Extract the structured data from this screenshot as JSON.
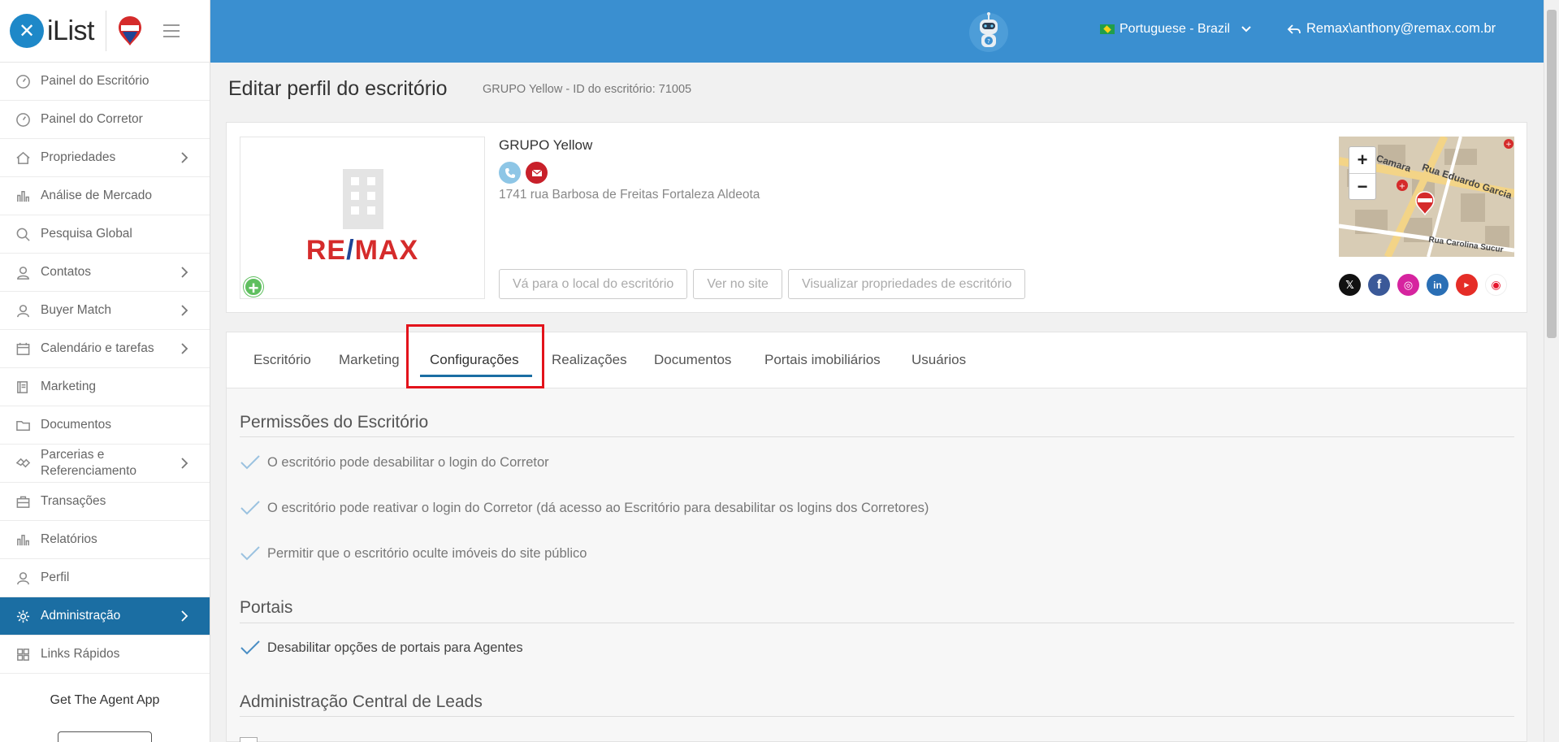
{
  "brand": {
    "name": "iList"
  },
  "nav": [
    {
      "label": "Painel do Escritório",
      "icon": "gauge-icon",
      "chevron": false
    },
    {
      "label": "Painel do Corretor",
      "icon": "gauge-icon",
      "chevron": false
    },
    {
      "label": "Propriedades",
      "icon": "home-icon",
      "chevron": true
    },
    {
      "label": "Análise de Mercado",
      "icon": "bar-chart-icon",
      "chevron": false
    },
    {
      "label": "Pesquisa Global",
      "icon": "search-icon",
      "chevron": false
    },
    {
      "label": "Contatos",
      "icon": "contacts-icon",
      "chevron": true
    },
    {
      "label": "Buyer Match",
      "icon": "user-icon",
      "chevron": true
    },
    {
      "label": "Calendário e tarefas",
      "icon": "calendar-icon",
      "chevron": true
    },
    {
      "label": "Marketing",
      "icon": "book-icon",
      "chevron": false
    },
    {
      "label": "Documentos",
      "icon": "folder-icon",
      "chevron": false
    },
    {
      "label": "Parcerias e Referenciamento",
      "icon": "handshake-icon",
      "chevron": true
    },
    {
      "label": "Transações",
      "icon": "briefcase-icon",
      "chevron": false
    },
    {
      "label": "Relatórios",
      "icon": "bar-chart-icon",
      "chevron": false
    },
    {
      "label": "Perfil",
      "icon": "user-icon",
      "chevron": false
    },
    {
      "label": "Administração",
      "icon": "gear-icon",
      "chevron": true,
      "active": true
    },
    {
      "label": "Links Rápidos",
      "icon": "grid-icon",
      "chevron": false
    }
  ],
  "agent_app": "Get The Agent App",
  "header": {
    "language": "Portuguese - Brazil",
    "user": "Remax\\anthony@remax.com.br"
  },
  "page": {
    "title": "Editar perfil do escritório",
    "subtitle": "GRUPO Yellow - ID do escritório: 71005"
  },
  "office": {
    "name": "GRUPO Yellow",
    "address": "1741 rua Barbosa de Freitas Fortaleza Aldeota",
    "logo_text_left": "RE",
    "logo_text_right": "MAX",
    "buttons": [
      "Vá para o local do escritório",
      "Ver no site",
      "Visualizar propriedades de escritório"
    ]
  },
  "map": {
    "street1": "Rua Camara",
    "street2": "Rua Eduardo Garcia",
    "street3": "Rua Carolina Sucur"
  },
  "tabs": [
    "Escritório",
    "Marketing",
    "Configurações",
    "Realizações",
    "Documentos",
    "Portais imobiliários",
    "Usuários"
  ],
  "sections": {
    "permissions_title": "Permissões do Escritório",
    "permissions": [
      "O escritório pode desabilitar o login do Corretor",
      "O escritório pode reativar o login do Corretor (dá acesso ao Escritório para desabilitar os logins dos Corretores)",
      "Permitir que o escritório oculte imóveis do site público"
    ],
    "portals_title": "Portais",
    "portals": [
      "Desabilitar opções de portais para Agentes"
    ],
    "leads_title": "Administração Central de Leads"
  },
  "colors": {
    "header": "#3a8fd0",
    "active_nav": "#1b6ea3",
    "highlight": "#e3131b"
  }
}
